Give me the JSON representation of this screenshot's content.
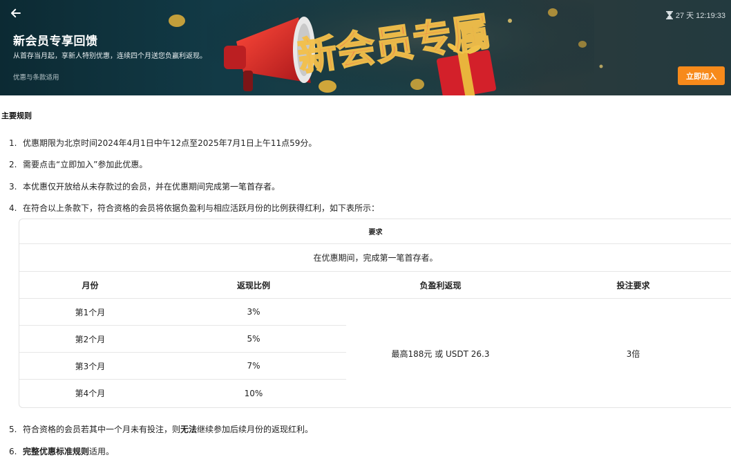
{
  "banner": {
    "title": "新会员专享回馈",
    "subtitle": "从首存当月起，享新人特别优惠，连续四个月送您负赢利返现。",
    "terms_link": "优惠与条款适用",
    "timer": "27 天 12:19:33",
    "join_button": "立即加入",
    "art_text": "新会员专属",
    "icons": {
      "back": "arrow-left-icon",
      "timer": "hourglass-icon"
    },
    "colors": {
      "accent": "#f78a1b",
      "background": "#123a46"
    }
  },
  "main": {
    "section_title": "主要规则",
    "rules": [
      {
        "num": "1.",
        "text": "优惠期限为北京时间2024年4月1日中午12点至2025年7月1日上午11点59分。"
      },
      {
        "num": "2.",
        "text": "需要点击“立即加入”参加此优惠。"
      },
      {
        "num": "3.",
        "text": "本优惠仅开放给从未存款过的会员，并在优惠期间完成第一笔首存者。"
      },
      {
        "num": "4.",
        "text": "在符合以上条款下，符合资格的会员将依据负盈利与相应活跃月份的比例获得红利，如下表所示："
      }
    ],
    "rule5": {
      "num": "5.",
      "pre": "符合资格的会员若其中一个月未有投注，则",
      "bold": "无法",
      "post": "继续参加后续月份的返现红利。"
    },
    "rule6": {
      "num": "6.",
      "bold": "完整优惠标准规则",
      "post": "适用。"
    }
  },
  "table": {
    "header": "要求",
    "description": "在优惠期间，完成第一笔首存者。",
    "columns": [
      "月份",
      "返现比例",
      "负盈利返现",
      "投注要求"
    ],
    "rows": [
      {
        "month": "第1个月",
        "rate": "3%"
      },
      {
        "month": "第2个月",
        "rate": "5%"
      },
      {
        "month": "第3个月",
        "rate": "7%"
      },
      {
        "month": "第4个月",
        "rate": "10%"
      }
    ],
    "rebate": "最高188元 或 USDT 26.3",
    "wager": "3倍"
  }
}
